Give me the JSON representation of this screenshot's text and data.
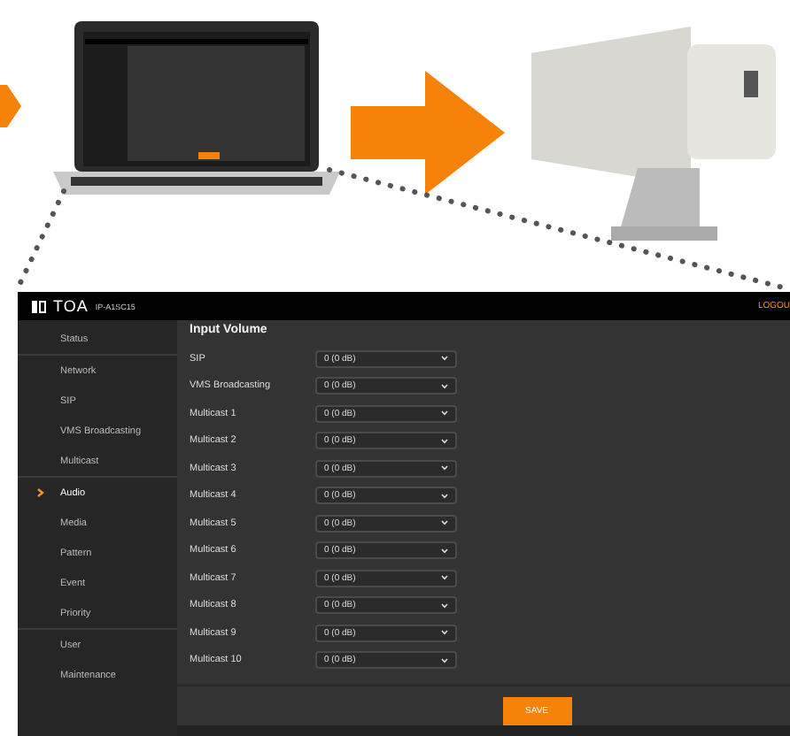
{
  "header": {
    "brand": "TOA",
    "model": "IP-A1SC15",
    "logout": "LOGOU"
  },
  "sidebar": {
    "groups": [
      {
        "items": [
          {
            "label": "Status",
            "selected": false
          }
        ]
      },
      {
        "items": [
          {
            "label": "Network",
            "selected": false
          },
          {
            "label": "SIP",
            "selected": false
          },
          {
            "label": "VMS Broadcasting",
            "selected": false
          },
          {
            "label": "Multicast",
            "selected": false
          }
        ]
      },
      {
        "items": [
          {
            "label": "Audio",
            "selected": true
          },
          {
            "label": "Media",
            "selected": false
          },
          {
            "label": "Pattern",
            "selected": false
          },
          {
            "label": "Event",
            "selected": false
          },
          {
            "label": "Priority",
            "selected": false
          }
        ]
      },
      {
        "items": [
          {
            "label": "User",
            "selected": false
          },
          {
            "label": "Maintenance",
            "selected": false
          }
        ]
      }
    ]
  },
  "section_title": "Input Volume",
  "rows": [
    {
      "label": "SIP",
      "value": "0 (0 dB)"
    },
    {
      "label": "VMS Broadcasting",
      "value": "0 (0 dB)"
    },
    {
      "label": "Multicast 1",
      "value": "0 (0 dB)"
    },
    {
      "label": "Multicast 2",
      "value": "0 (0 dB)"
    },
    {
      "label": "Multicast 3",
      "value": "0 (0 dB)"
    },
    {
      "label": "Multicast 4",
      "value": "0 (0 dB)"
    },
    {
      "label": "Multicast 5",
      "value": "0 (0 dB)"
    },
    {
      "label": "Multicast 6",
      "value": "0 (0 dB)"
    },
    {
      "label": "Multicast 7",
      "value": "0 (0 dB)"
    },
    {
      "label": "Multicast 8",
      "value": "0 (0 dB)"
    },
    {
      "label": "Multicast 9",
      "value": "0 (0 dB)"
    },
    {
      "label": "Multicast 10",
      "value": "0 (0 dB)"
    }
  ],
  "save_button": "SAVE"
}
